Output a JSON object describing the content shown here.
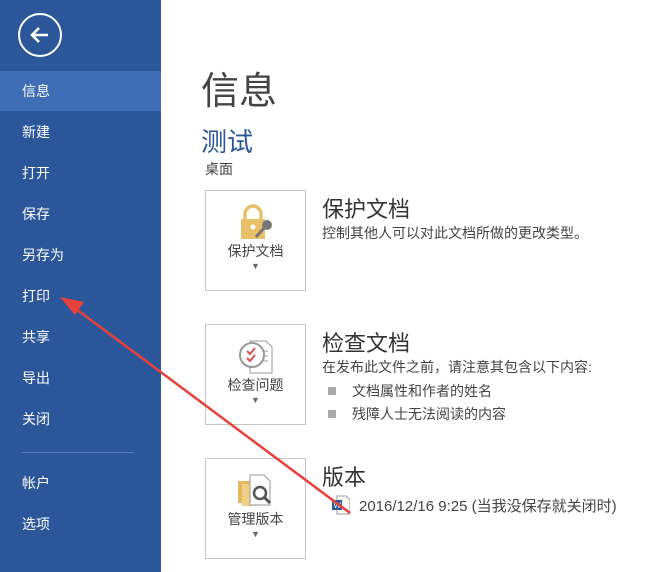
{
  "sidebar": {
    "items": [
      {
        "label": "信息"
      },
      {
        "label": "新建"
      },
      {
        "label": "打开"
      },
      {
        "label": "保存"
      },
      {
        "label": "另存为"
      },
      {
        "label": "打印"
      },
      {
        "label": "共享"
      },
      {
        "label": "导出"
      },
      {
        "label": "关闭"
      },
      {
        "label": "帐户"
      },
      {
        "label": "选项"
      }
    ]
  },
  "main": {
    "title": "信息",
    "doc_name": "测试",
    "location": "桌面",
    "protect": {
      "button": "保护文档",
      "heading": "保护文档",
      "desc": "控制其他人可以对此文档所做的更改类型。"
    },
    "inspect": {
      "button": "检查问题",
      "heading": "检查文档",
      "desc": "在发布此文件之前，请注意其包含以下内容:",
      "bullets": [
        "文档属性和作者的姓名",
        "残障人士无法阅读的内容"
      ]
    },
    "versions": {
      "button": "管理版本",
      "heading": "版本",
      "entry": "2016/12/16 9:25 (当我没保存就关闭时)"
    }
  },
  "colors": {
    "sidebar": "#2b579a",
    "selected": "#3e6db5",
    "annotation": "#e8403a"
  }
}
